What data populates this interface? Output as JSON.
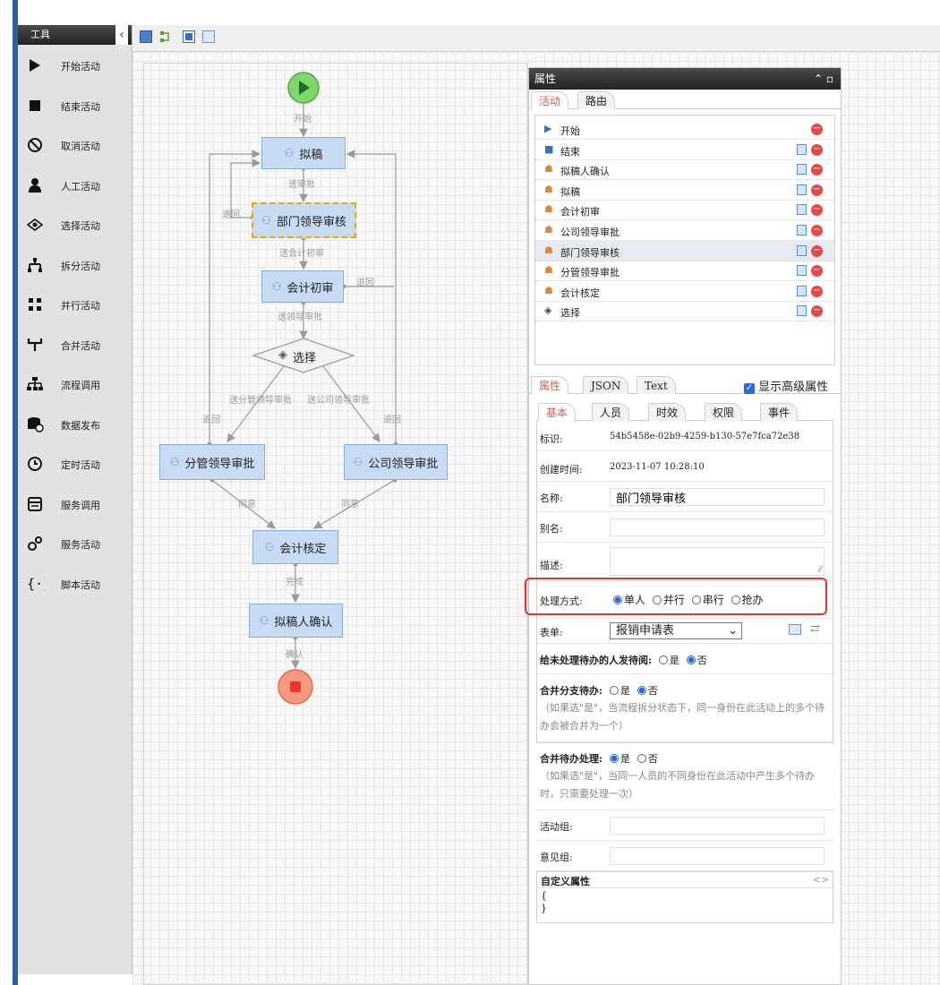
{
  "toolbox": {
    "title": "工具",
    "collapse_icon": "chevron-left",
    "items": [
      {
        "label": "开始活动",
        "icon": "play-icon"
      },
      {
        "label": "结束活动",
        "icon": "stop-icon"
      },
      {
        "label": "取消活动",
        "icon": "cancel-icon"
      },
      {
        "label": "人工活动",
        "icon": "person-icon"
      },
      {
        "label": "选择活动",
        "icon": "choice-icon"
      },
      {
        "label": "拆分活动",
        "icon": "split-icon"
      },
      {
        "label": "并行活动",
        "icon": "parallel-icon"
      },
      {
        "label": "合并活动",
        "icon": "merge-icon"
      },
      {
        "label": "流程调用",
        "icon": "subprocess-icon"
      },
      {
        "label": "数据发布",
        "icon": "database-icon"
      },
      {
        "label": "定时活动",
        "icon": "clock-icon"
      },
      {
        "label": "服务调用",
        "icon": "service-call-icon"
      },
      {
        "label": "服务活动",
        "icon": "gears-icon"
      },
      {
        "label": "脚本活动",
        "icon": "braces-icon"
      }
    ]
  },
  "flow": {
    "nodes": {
      "draft": "拟稿",
      "dept": "部门领导审核",
      "acc_first": "会计初审",
      "choice": "选择",
      "branch": "分管领导审批",
      "company": "公司领导审批",
      "acc_final": "会计核定",
      "confirm": "拟稿人确认"
    },
    "labels": {
      "start": "开始",
      "send_review": "送审批",
      "send_acc": "送会计初审",
      "send_lead": "送领导审批",
      "send_branch": "送分管领导审批",
      "send_company": "送公司领导审批",
      "back": "退回",
      "agree": "同意",
      "done": "完成",
      "confirm": "确认"
    }
  },
  "props": {
    "title": "属性",
    "header_icons": [
      "collapse-up-icon",
      "maximize-icon"
    ],
    "top_tabs": [
      "活动",
      "路由"
    ],
    "activities": [
      {
        "name": "开始",
        "icon": "play-icon",
        "copy": false
      },
      {
        "name": "结束",
        "icon": "stop-icon",
        "copy": true
      },
      {
        "name": "拟稿人确认",
        "icon": "person-icon",
        "copy": true
      },
      {
        "name": "拟稿",
        "icon": "person-icon",
        "copy": true
      },
      {
        "name": "会计初审",
        "icon": "person-icon",
        "copy": true
      },
      {
        "name": "公司领导审批",
        "icon": "person-icon",
        "copy": true
      },
      {
        "name": "部门领导审核",
        "icon": "person-icon",
        "copy": true,
        "selected": true
      },
      {
        "name": "分管领导审批",
        "icon": "person-icon",
        "copy": true
      },
      {
        "name": "会计核定",
        "icon": "person-icon",
        "copy": true
      },
      {
        "name": "选择",
        "icon": "choice-icon",
        "copy": true
      }
    ],
    "mid_tabs": [
      "属性",
      "JSON",
      "Text"
    ],
    "advanced_label": "显示高级属性",
    "sub_tabs": [
      "基本",
      "人员",
      "时效",
      "权限",
      "事件"
    ],
    "fields": {
      "id_label": "标识:",
      "id_value": "54b5458e-02b9-4259-b130-57e7fca72e38",
      "created_label": "创建时间:",
      "created_value": "2023-11-07 10:28:10",
      "name_label": "名称:",
      "name_value": "部门领导审核",
      "alias_label": "别名:",
      "desc_label": "描述:",
      "mode_label": "处理方式:",
      "mode_options": [
        "单人",
        "并行",
        "串行",
        "抢办"
      ],
      "form_label": "表单:",
      "form_value": "报销申请表",
      "pending_label": "给未处理待办的人发待阅:",
      "merge_branch_label": "合并分支待办:",
      "merge_branch_note": "（如果选\"是\"，当流程拆分状态下，同一身份在此活动上的多个待办会被合并为一个）",
      "merge_pending_label": "合并待办处理:",
      "merge_pending_note": "（如果选\"是\"，当同一人员的不同身份在此活动中产生多个待办时，只需要处理一次）",
      "yes": "是",
      "no": "否",
      "group_label": "活动组:",
      "opinion_label": "意见组:",
      "custom_label": "自定义属性",
      "custom_open": "{",
      "custom_close": "}"
    }
  }
}
